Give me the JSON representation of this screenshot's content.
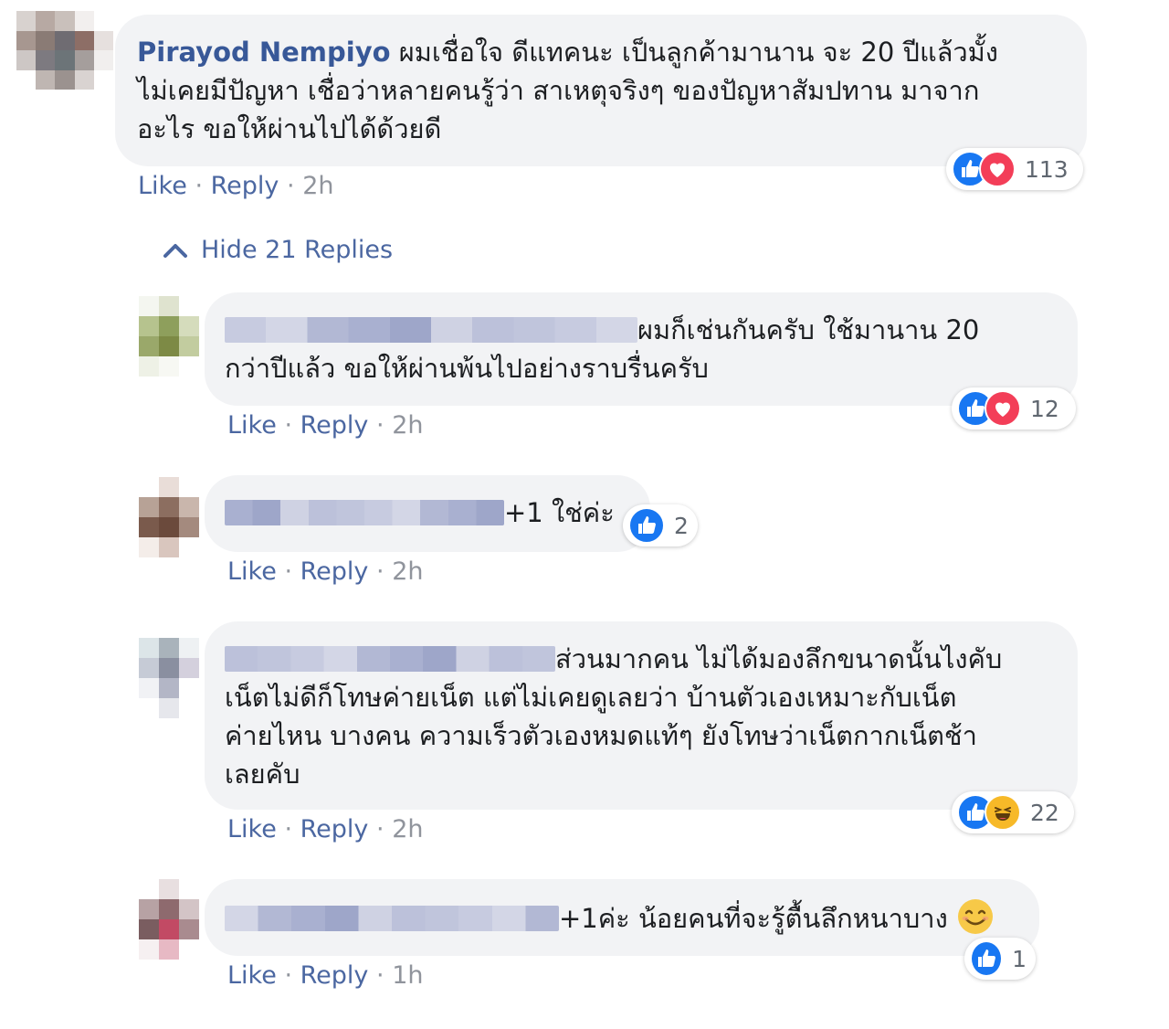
{
  "main_comment": {
    "author": "Pirayod Nempiyo",
    "text_lines": [
      "ผมเชื่อใจ ดีแทคนะ เป็นลูกค้ามานาน จะ 20 ปีแล้วมั้ง",
      "ไม่เคยมีปัญหา เชื่อว่าหลายคนรู้ว่า สาเหตุจริงๆ ของปัญหาสัมปทาน มาจาก",
      "อะไร ขอให้ผ่านไปได้ด้วยดี"
    ],
    "reactions": [
      "like-icon",
      "love-icon"
    ],
    "reaction_count": "113",
    "like_label": "Like",
    "reply_label": "Reply",
    "separator": "·",
    "time": "2h"
  },
  "toggle_replies": {
    "label": "Hide 21 Replies",
    "icon": "chevron-up-icon"
  },
  "replies": [
    {
      "text_lines": [
        "ผมก็เช่นกันครับ ใช้มานาน 20",
        "กว่าปีแล้ว ขอให้ผ่านพ้นไปอย่างราบรื่นครับ"
      ],
      "reactions": [
        "like-icon",
        "love-icon"
      ],
      "reaction_count": "12",
      "like_label": "Like",
      "reply_label": "Reply",
      "separator": "·",
      "time": "2h"
    },
    {
      "text_lines": [
        "+1 ใช่ค่ะ"
      ],
      "reactions": [
        "like-icon"
      ],
      "reaction_count": "2",
      "like_label": "Like",
      "reply_label": "Reply",
      "separator": "·",
      "time": "2h"
    },
    {
      "text_lines": [
        "ส่วนมากคน ไม่ได้มองลึกขนาดนั้นไงคับ",
        "เน็ตไม่ดีก็โทษค่ายเน็ต แต่ไม่เคยดูเลยว่า บ้านตัวเองเหมาะกับเน็ต",
        "ค่ายไหน บางคน ความเร็วตัวเองหมดแท้ๆ ยังโทษว่าเน็ตกากเน็ตช้า",
        "เลยคับ"
      ],
      "reactions": [
        "like-icon",
        "haha-icon"
      ],
      "reaction_count": "22",
      "like_label": "Like",
      "reply_label": "Reply",
      "separator": "·",
      "time": "2h"
    },
    {
      "text_lines": [
        "+1ค่ะ น้อยคนที่จะรู้ตื้นลึกหนาบาง"
      ],
      "inline_emoji": "smiling-face-emoji",
      "reactions": [
        "like-icon"
      ],
      "reaction_count": "1",
      "like_label": "Like",
      "reply_label": "Reply",
      "separator": "·",
      "time": "1h"
    }
  ],
  "colors": {
    "bubble_bg": "#f2f3f5",
    "link": "#4b67a1",
    "author": "#385898",
    "like_blue": "#1877f2",
    "love_red": "#f33e58",
    "haha_yellow": "#f7b928"
  }
}
